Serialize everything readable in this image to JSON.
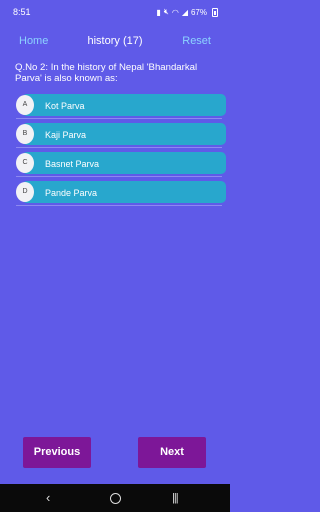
{
  "status_bar": {
    "time": "8:51",
    "battery": "67%",
    "icons": [
      "sim-icon",
      "mute-icon",
      "wifi-icon",
      "signal-icon",
      "battery-icon"
    ]
  },
  "header": {
    "home_label": "Home",
    "title": "history (17)",
    "reset_label": "Reset"
  },
  "question": {
    "text": "Q.No 2: In the history of Nepal 'Bhandarkal Parva' is also known as:"
  },
  "options": [
    {
      "letter": "A",
      "text": "Kot Parva"
    },
    {
      "letter": "B",
      "text": "Kaji Parva"
    },
    {
      "letter": "C",
      "text": "Basnet Parva"
    },
    {
      "letter": "D",
      "text": "Pande Parva"
    }
  ],
  "footer": {
    "previous_label": "Previous",
    "next_label": "Next"
  },
  "nav": {
    "back": "‹",
    "home": "○",
    "recents": "|||"
  },
  "colors": {
    "background": "#5f5ae8",
    "option": "#28a7cd",
    "button": "#7d1798",
    "link": "#8cd3ff"
  }
}
